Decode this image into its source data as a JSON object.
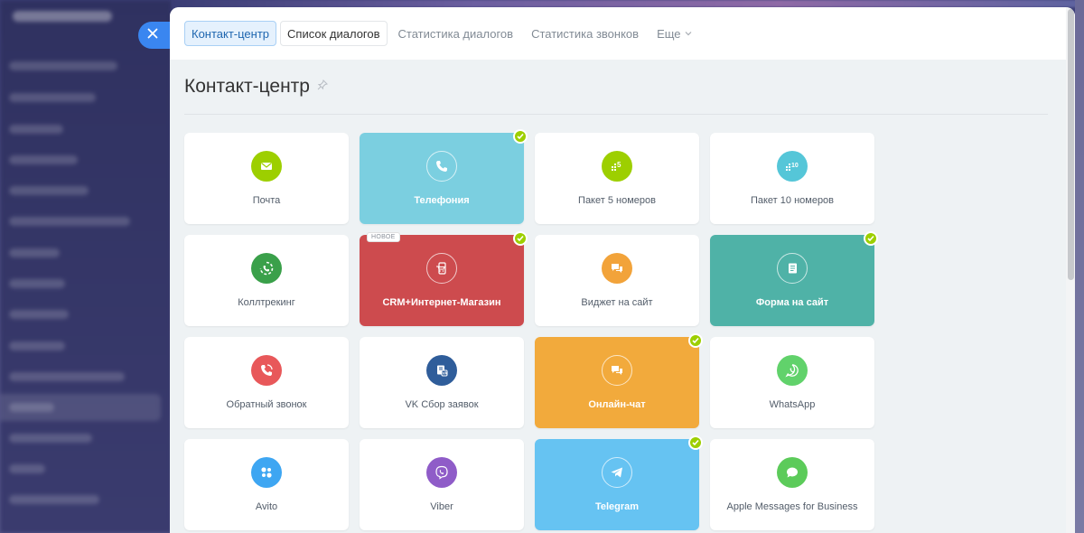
{
  "colors": {
    "accent": "#3a86f0",
    "check": "#9dcf00",
    "panel_bg": "#eef2f4"
  },
  "close_button": {
    "icon": "close-icon"
  },
  "tabs": [
    {
      "label": "Контакт-центр",
      "state": "active"
    },
    {
      "label": "Список диалогов",
      "state": "bordered"
    },
    {
      "label": "Статистика диалогов",
      "state": "plain"
    },
    {
      "label": "Статистика звонков",
      "state": "plain"
    },
    {
      "label": "Еще",
      "state": "dropdown"
    }
  ],
  "page": {
    "title": "Контакт-центр",
    "pin_icon": "pin-icon"
  },
  "tiles": [
    {
      "label": "Почта",
      "icon": "mail-icon",
      "color": "#9dcf00",
      "connected": false
    },
    {
      "label": "Телефония",
      "icon": "phone-icon",
      "color": "#7bcfe0",
      "connected": true
    },
    {
      "label": "Пакет 5 номеров",
      "icon": "number-pack-5-icon",
      "color": "#9dcf00",
      "connected": false
    },
    {
      "label": "Пакет 10 номеров",
      "icon": "number-pack-10-icon",
      "color": "#55c6d8",
      "connected": false
    },
    {
      "label": "Коллтрекинг",
      "icon": "call-tracking-icon",
      "color": "#3aa04a",
      "connected": false
    },
    {
      "label": "CRM+Интернет-Магазин",
      "icon": "shop-icon",
      "color": "#cd4b4e",
      "connected": true,
      "badge": "НОВОЕ"
    },
    {
      "label": "Виджет на сайт",
      "icon": "chat-bubbles-icon",
      "color": "#f2a33a",
      "connected": false
    },
    {
      "label": "Форма на сайт",
      "icon": "form-icon",
      "color": "#4fb2a7",
      "connected": true
    },
    {
      "label": "Обратный звонок",
      "icon": "callback-icon",
      "color": "#e8585a",
      "connected": false
    },
    {
      "label": "VK Сбор заявок",
      "icon": "vk-icon",
      "color": "#2f5d9a",
      "connected": false
    },
    {
      "label": "Онлайн-чат",
      "icon": "chat-bubbles-icon",
      "color": "#f2aa3c",
      "connected": true
    },
    {
      "label": "WhatsApp",
      "icon": "whatsapp-icon",
      "color": "#61d26b",
      "connected": false
    },
    {
      "label": "Avito",
      "icon": "avito-icon",
      "color": "#3ea6f2",
      "connected": false
    },
    {
      "label": "Viber",
      "icon": "viber-icon",
      "color": "#8f5cc8",
      "connected": false
    },
    {
      "label": "Telegram",
      "icon": "telegram-icon",
      "color": "#66c3f2",
      "connected": true
    },
    {
      "label": "Apple Messages for Business",
      "icon": "apple-messages-icon",
      "color": "#5ccb5a",
      "connected": false
    }
  ]
}
